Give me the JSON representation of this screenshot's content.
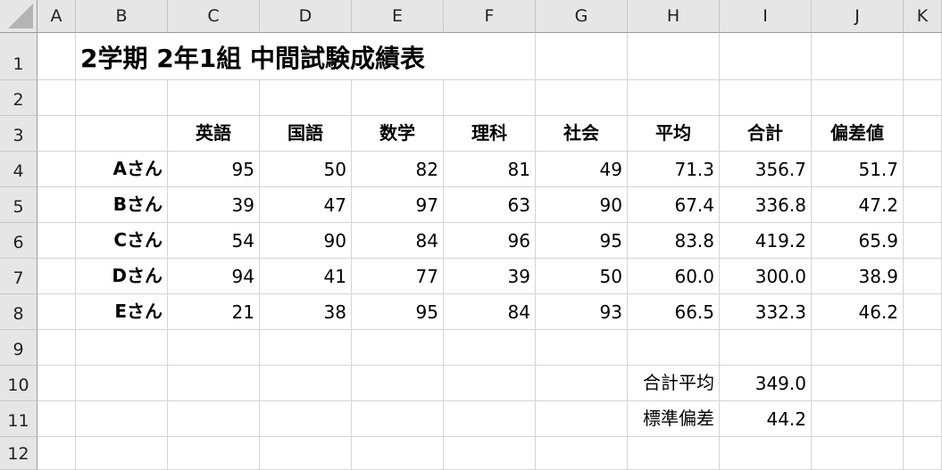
{
  "columns": [
    "A",
    "B",
    "C",
    "D",
    "E",
    "F",
    "G",
    "H",
    "I",
    "J",
    "K"
  ],
  "rows": [
    "1",
    "2",
    "3",
    "4",
    "5",
    "6",
    "7",
    "8",
    "9",
    "10",
    "11",
    "12"
  ],
  "title": "2学期 2年1組 中間試験成績表",
  "table": {
    "headers": [
      "英語",
      "国語",
      "数学",
      "理科",
      "社会",
      "平均",
      "合計",
      "偏差値"
    ],
    "records": [
      {
        "name": "Aさん",
        "values": [
          "95",
          "50",
          "82",
          "81",
          "49",
          "71.3",
          "356.7",
          "51.7"
        ]
      },
      {
        "name": "Bさん",
        "values": [
          "39",
          "47",
          "97",
          "63",
          "90",
          "67.4",
          "336.8",
          "47.2"
        ]
      },
      {
        "name": "Cさん",
        "values": [
          "54",
          "90",
          "84",
          "96",
          "95",
          "83.8",
          "419.2",
          "65.9"
        ]
      },
      {
        "name": "Dさん",
        "values": [
          "94",
          "41",
          "77",
          "39",
          "50",
          "60.0",
          "300.0",
          "38.9"
        ]
      },
      {
        "name": "Eさん",
        "values": [
          "21",
          "38",
          "95",
          "84",
          "93",
          "66.5",
          "332.3",
          "46.2"
        ]
      }
    ]
  },
  "summary": [
    {
      "label": "合計平均",
      "value": "349.0"
    },
    {
      "label": "標準偏差",
      "value": "44.2"
    }
  ]
}
